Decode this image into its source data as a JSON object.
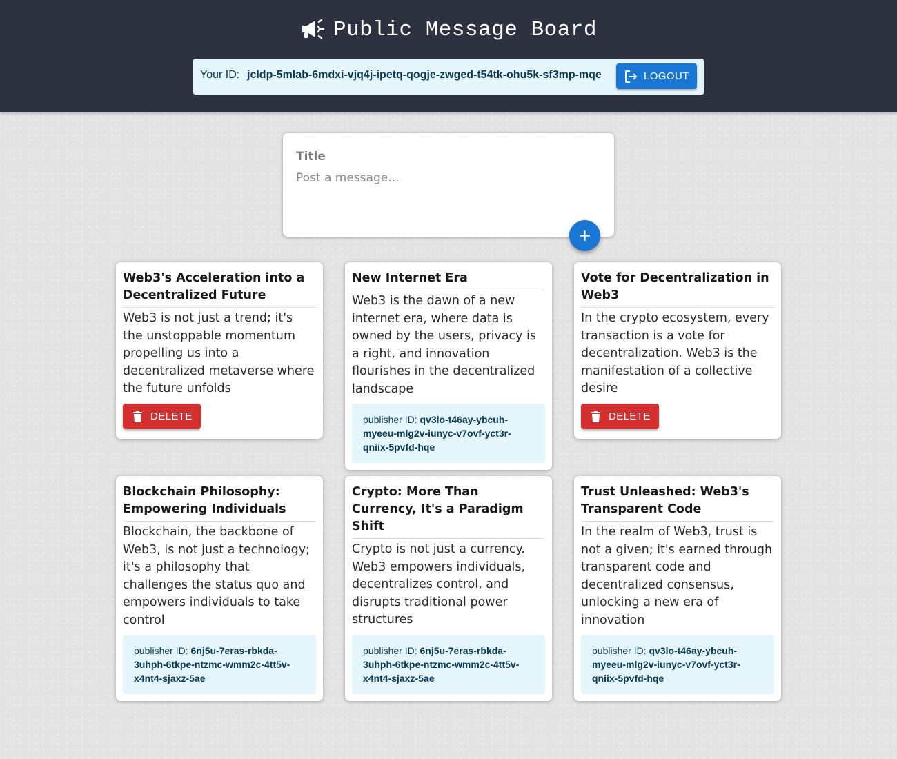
{
  "header": {
    "title": "Public Message Board",
    "icon": "megaphone-icon",
    "id_label": "Your ID:",
    "user_id": "jcldp-5mlab-6mdxi-vjq4j-ipetq-qogje-zwged-t54tk-ohu5k-sf3mp-mqe",
    "logout_label": "LOGOUT"
  },
  "compose": {
    "title_placeholder": "Title",
    "message_placeholder": "Post a message..."
  },
  "colors": {
    "header_bg": "#2d3240",
    "primary": "#1976d2",
    "danger": "#d32f2f",
    "info_bg": "#e5f5fc"
  },
  "notes": [
    {
      "title": "Web3's Acceleration into a Decentralized Future",
      "body": "Web3 is not just a trend; it's the unstoppable momentum propelling us into a decentralized metaverse where the future unfolds",
      "delete_label": "DELETE"
    },
    {
      "title": "New Internet Era",
      "body": "Web3 is the dawn of a new internet era, where data is owned by the users, privacy is a right, and innovation flourishes in the decentralized landscape",
      "publisher_label": "publisher ID:",
      "publisher_id": "qv3lo-t46ay-ybcuh-myeeu-mlg2v-iunyc-v7ovf-yct3r-qniix-5pvfd-hqe"
    },
    {
      "title": "Vote for Decentralization in Web3",
      "body": "In the crypto ecosystem, every transaction is a vote for decentralization. Web3 is the manifestation of a collective desire",
      "delete_label": "DELETE"
    },
    {
      "title": "Blockchain Philosophy: Empowering Individuals",
      "body": "Blockchain, the backbone of Web3, is not just a technology; it's a philosophy that challenges the status quo and empowers individuals to take control",
      "publisher_label": "publisher ID:",
      "publisher_id": "6nj5u-7eras-rbkda-3uhph-6tkpe-ntzmc-wmm2c-4tt5v-x4nt4-sjaxz-5ae"
    },
    {
      "title": "Crypto: More Than Currency, It's a Paradigm Shift",
      "body": "Crypto is not just a currency. Web3 empowers individuals, decentralizes control, and disrupts traditional power structures",
      "publisher_label": "publisher ID:",
      "publisher_id": "6nj5u-7eras-rbkda-3uhph-6tkpe-ntzmc-wmm2c-4tt5v-x4nt4-sjaxz-5ae"
    },
    {
      "title": "Trust Unleashed: Web3's Transparent Code",
      "body": "In the realm of Web3, trust is not a given; it's earned through transparent code and decentralized consensus, unlocking a new era of innovation",
      "publisher_label": "publisher ID:",
      "publisher_id": "qv3lo-t46ay-ybcuh-myeeu-mlg2v-iunyc-v7ovf-yct3r-qniix-5pvfd-hqe"
    }
  ]
}
